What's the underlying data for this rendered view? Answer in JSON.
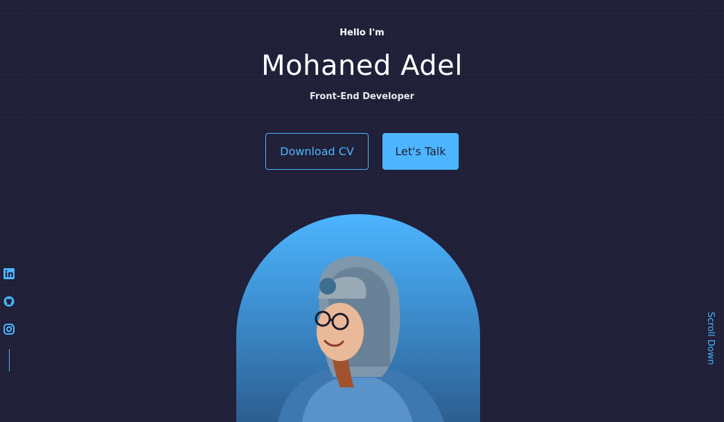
{
  "intro": {
    "greeting": "Hello I'm",
    "name": "Mohaned Adel",
    "role": "Front-End Developer"
  },
  "cta": {
    "download_label": "Download CV",
    "talk_label": "Let's Talk"
  },
  "socials": [
    {
      "icon": "linkedin-icon"
    },
    {
      "icon": "github-icon"
    },
    {
      "icon": "instagram-icon"
    }
  ],
  "scroll_label": "Scroll Down",
  "colors": {
    "background": "#1f1f38",
    "accent": "#4db5ff",
    "text": "#ffffff"
  }
}
